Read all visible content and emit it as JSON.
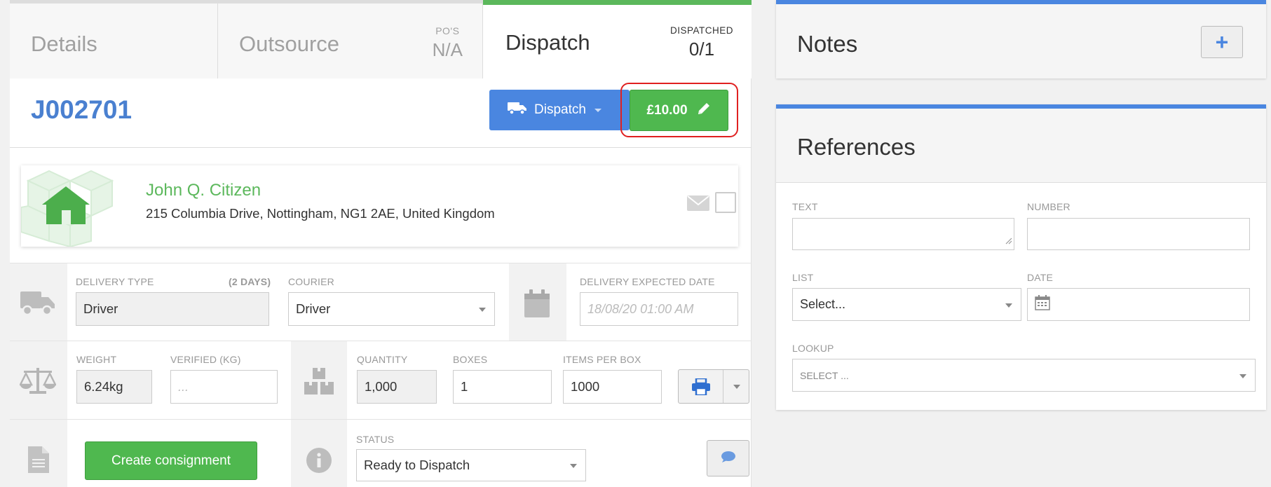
{
  "tabs": {
    "details_label": "Details",
    "outsource_label": "Outsource",
    "pos_key": "PO'S",
    "pos_value": "N/A",
    "dispatch_label": "Dispatch",
    "dispatched_key": "DISPATCHED",
    "dispatched_value": "0/1"
  },
  "job": {
    "id": "J002701",
    "dispatch_button": "Dispatch",
    "price_button": "£10.00"
  },
  "contact": {
    "name": "John Q. Citizen",
    "address": "215 Columbia Drive, Nottingham, NG1 2AE, United Kingdom"
  },
  "delivery": {
    "type_label": "DELIVERY TYPE",
    "type_days": "(2 DAYS)",
    "type_value": "Driver",
    "courier_label": "COURIER",
    "courier_value": "Driver",
    "expected_label": "DELIVERY EXPECTED DATE",
    "expected_placeholder": "18/08/20 01:00 AM"
  },
  "weights": {
    "weight_label": "WEIGHT",
    "weight_value": "6.24kg",
    "verified_label": "VERIFIED (KG)",
    "verified_placeholder": "...",
    "quantity_label": "QUANTITY",
    "quantity_value": "1,000",
    "boxes_label": "BOXES",
    "boxes_value": "1",
    "items_label": "ITEMS PER BOX",
    "items_value": "1000"
  },
  "consignment": {
    "create_button": "Create consignment",
    "status_label": "STATUS",
    "status_value": "Ready to Dispatch"
  },
  "notes": {
    "title": "Notes",
    "add_symbol": "+"
  },
  "references": {
    "title": "References",
    "text_label": "TEXT",
    "number_label": "NUMBER",
    "list_label": "LIST",
    "list_value": "Select...",
    "date_label": "DATE",
    "lookup_label": "LOOKUP",
    "lookup_value": "SELECT ..."
  },
  "colors": {
    "accent_blue": "#4a86e0",
    "accent_green": "#5cb85c",
    "highlight_red": "#e02020"
  }
}
